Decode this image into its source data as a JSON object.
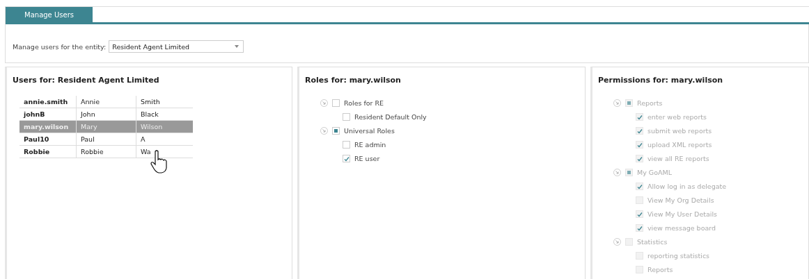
{
  "tabs": [
    {
      "label": "Manage Users",
      "selected": true
    }
  ],
  "entity": {
    "label": "Manage users for the entity:",
    "value": "Resident Agent Limited"
  },
  "users": {
    "title": "Users for: Resident Agent Limited",
    "rows": [
      {
        "cells": [
          "annie.smith",
          "Annie",
          "Smith"
        ],
        "selected": false
      },
      {
        "cells": [
          "johnB",
          "John",
          "Black"
        ],
        "selected": false
      },
      {
        "cells": [
          "mary.wilson",
          "Mary",
          "Wilson"
        ],
        "selected": true
      },
      {
        "cells": [
          "Paul10",
          "Paul",
          "A"
        ],
        "selected": false
      },
      {
        "cells": [
          "Robbie",
          "Robbie",
          "Wa"
        ],
        "selected": false
      }
    ]
  },
  "roles": {
    "title": "Roles for: mary.wilson",
    "disabled": false,
    "items": [
      {
        "label": "Roles for RE",
        "partial": false,
        "children": [
          {
            "label": "Resident Default Only",
            "checked": false
          }
        ]
      },
      {
        "label": "Universal Roles",
        "partial": true,
        "children": [
          {
            "label": "RE admin",
            "checked": false
          },
          {
            "label": "RE user",
            "checked": true
          }
        ]
      }
    ]
  },
  "permissions": {
    "title": "Permissions for: mary.wilson",
    "disabled": true,
    "items": [
      {
        "label": "Reports",
        "partial": true,
        "children": [
          {
            "label": "enter web reports",
            "checked": true
          },
          {
            "label": "submit web reports",
            "checked": true
          },
          {
            "label": "upload XML reports",
            "checked": true
          },
          {
            "label": "view all RE reports",
            "checked": true
          }
        ]
      },
      {
        "label": "My GoAML",
        "partial": true,
        "children": [
          {
            "label": "Allow log in as delegate",
            "checked": true
          },
          {
            "label": "View My Org Details",
            "checked": false
          },
          {
            "label": "View My User Details",
            "checked": true
          },
          {
            "label": "view message board",
            "checked": true
          }
        ]
      },
      {
        "label": "Statistics",
        "partial": false,
        "children": [
          {
            "label": "reporting statistics",
            "checked": false
          },
          {
            "label": "Reports",
            "checked": false
          }
        ]
      }
    ]
  }
}
